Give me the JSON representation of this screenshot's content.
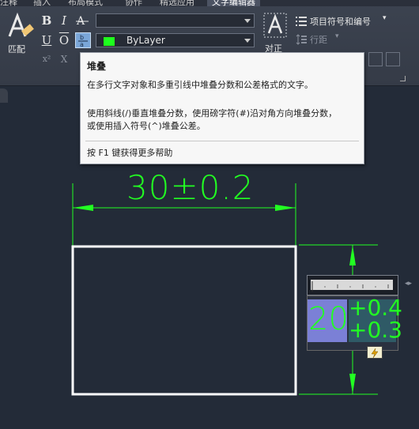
{
  "ribbon": {
    "tabs": [
      "注释",
      "插入",
      "布局模式",
      "协作",
      "精选应用",
      "文字编辑器"
    ],
    "match_label": "匹配",
    "bold_label": "B",
    "italic_label": "I",
    "underline_label": "U",
    "overline_label": "O",
    "superscript_label": "x²",
    "subscript_label": "X",
    "stack_label": "b/a",
    "font_combo_value": "",
    "color_combo_value": "ByLayer",
    "color_swatch": "#1eff1e",
    "justify_label": "对正",
    "bullets_label": "项目符号和编号",
    "line_spacing_label": "行距"
  },
  "tooltip": {
    "title": "堆叠",
    "description": "在多行文字对象和多重引线中堆叠分数和公差格式的文字。",
    "detail_line1": "使用斜线(/)垂直堆叠分数，使用磅字符(#)沿对角方向堆叠分数，",
    "detail_line2": "或使用插入符号(^)堆叠公差。",
    "help_text": "按 F1 键获得更多帮助"
  },
  "drawing": {
    "dimension_text": "30±0.2",
    "edit_value": "20",
    "tolerance_plus": "+0.4",
    "tolerance_minus": "+0.3",
    "line_color": "#22ff22",
    "rect_color": "#ffffff"
  }
}
